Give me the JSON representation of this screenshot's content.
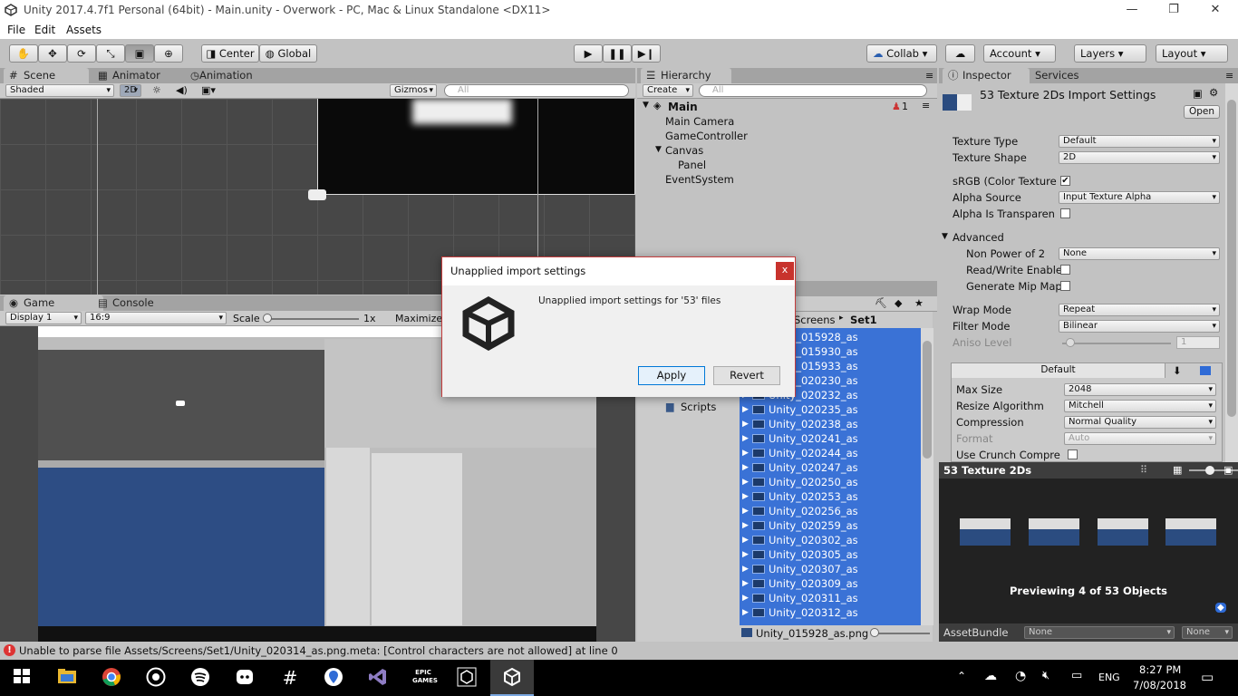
{
  "window": {
    "title": "Unity 2017.4.7f1 Personal (64bit) - Main.unity - Overwork - PC, Mac & Linux Standalone <DX11>",
    "min": "—",
    "restore": "❐",
    "close": "✕"
  },
  "menu": {
    "file": "File",
    "edit": "Edit",
    "assets": "Assets"
  },
  "toolbar": {
    "center": "Center",
    "global": "Global",
    "collab": "Collab",
    "account": "Account",
    "layers": "Layers",
    "layout": "Layout"
  },
  "scene": {
    "tab_scene": "Scene",
    "tab_animator": "Animator",
    "tab_animation": "Animation",
    "shaded": "Shaded",
    "mode2d": "2D",
    "gizmos": "Gizmos",
    "search_placeholder": "All"
  },
  "game": {
    "tab_game": "Game",
    "tab_console": "Console",
    "display": "Display 1",
    "aspect": "16:9",
    "scale_label": "Scale",
    "scale_value": "1x",
    "maximize": "Maximize"
  },
  "hierarchy": {
    "tab": "Hierarchy",
    "create": "Create",
    "search_placeholder": "All",
    "scene_name": "Main",
    "count": "1",
    "items": [
      "Main Camera",
      "GameController",
      "Canvas",
      "Panel",
      "EventSystem"
    ]
  },
  "project": {
    "breadcrumb_parent": "Screens",
    "breadcrumb_sep": "▸",
    "breadcrumb_current": "Set1",
    "folder": "Scripts",
    "files": [
      "Unity_015928_as",
      "Unity_015930_as",
      "Unity_015933_as",
      "Unity_020230_as",
      "Unity_020232_as",
      "Unity_020235_as",
      "Unity_020238_as",
      "Unity_020241_as",
      "Unity_020244_as",
      "Unity_020247_as",
      "Unity_020250_as",
      "Unity_020253_as",
      "Unity_020256_as",
      "Unity_020259_as",
      "Unity_020302_as",
      "Unity_020305_as",
      "Unity_020307_as",
      "Unity_020309_as",
      "Unity_020311_as",
      "Unity_020312_as"
    ],
    "footer_file": "Unity_015928_as.png"
  },
  "inspector": {
    "tab": "Inspector",
    "tab_services": "Services",
    "title": "53 Texture 2Ds Import Settings",
    "open": "Open",
    "texture_type": {
      "label": "Texture Type",
      "value": "Default"
    },
    "texture_shape": {
      "label": "Texture Shape",
      "value": "2D"
    },
    "srgb": {
      "label": "sRGB (Color Texture",
      "checked": true
    },
    "alpha_source": {
      "label": "Alpha Source",
      "value": "Input Texture Alpha"
    },
    "alpha_transparency": {
      "label": "Alpha Is Transparen",
      "checked": false
    },
    "advanced": "Advanced",
    "npot": {
      "label": "Non Power of 2",
      "value": "None"
    },
    "rw": {
      "label": "Read/Write Enable",
      "checked": false
    },
    "mipmap": {
      "label": "Generate Mip Map",
      "checked": false
    },
    "wrap": {
      "label": "Wrap Mode",
      "value": "Repeat"
    },
    "filter": {
      "label": "Filter Mode",
      "value": "Bilinear"
    },
    "aniso": {
      "label": "Aniso Level",
      "value": "1"
    },
    "platform_tab": "Default",
    "max_size": {
      "label": "Max Size",
      "value": "2048"
    },
    "resize": {
      "label": "Resize Algorithm",
      "value": "Mitchell"
    },
    "compression": {
      "label": "Compression",
      "value": "Normal Quality"
    },
    "format": {
      "label": "Format",
      "value": "Auto"
    },
    "crunch": {
      "label": "Use Crunch Compre",
      "checked": false
    }
  },
  "preview": {
    "title": "53 Texture 2Ds",
    "caption": "Previewing 4 of 53 Objects",
    "assetbundle": "AssetBundle",
    "ab_name": "None",
    "ab_variant": "None"
  },
  "dialog": {
    "title": "Unapplied import settings",
    "message": "Unapplied import settings for '53' files",
    "apply": "Apply",
    "revert": "Revert",
    "close": "x"
  },
  "status": {
    "message": "Unable to parse file Assets/Screens/Set1/Unity_020314_as.png.meta: [Control characters are not allowed] at line 0"
  },
  "taskbar": {
    "language": "ENG",
    "time": "8:27 PM",
    "date": "7/08/2018",
    "epic_line1": "EPIC",
    "epic_line2": "GAMES"
  }
}
